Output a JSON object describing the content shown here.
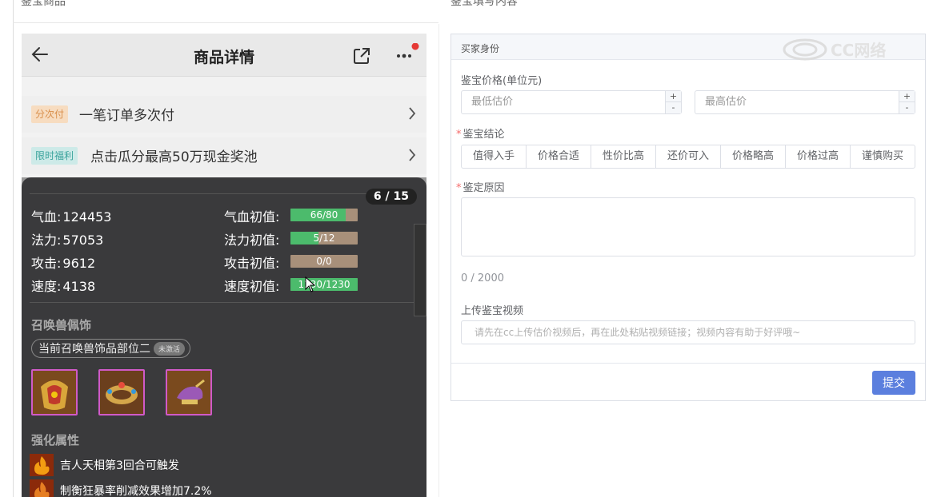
{
  "columns": {
    "left_title": "鉴宝商品",
    "right_title": "鉴宝填写内容"
  },
  "phone": {
    "nav": {
      "title": "商品详情"
    },
    "promos": [
      {
        "tag": "分次付",
        "text": "一笔订单多次付"
      },
      {
        "tag": "限时福利",
        "text": "点击瓜分最高50万现金奖池"
      }
    ],
    "page_indicator": "6 / 15",
    "stats": [
      {
        "label": "气血:",
        "value": "124453",
        "init_label": "气血初值:",
        "init_text": "66/80",
        "fill": 0.825
      },
      {
        "label": "法力:",
        "value": "57053",
        "init_label": "法力初值:",
        "init_text": "5/12",
        "fill": 0.42
      },
      {
        "label": "攻击:",
        "value": "9612",
        "init_label": "攻击初值:",
        "init_text": "0/0",
        "fill": 0
      },
      {
        "label": "速度:",
        "value": "4138",
        "init_label": "速度初值:",
        "init_text": "1230/1230",
        "fill": 1.0
      }
    ],
    "accessory_section": "召唤兽佩饰",
    "accessory_pill": "当前召唤兽饰品部位二",
    "accessory_lock": "未激活",
    "enhance_section": "强化属性",
    "enhancements": [
      "吉人天相第3回合可触发",
      "制衡狂暴率削减效果增加7.2%"
    ]
  },
  "form": {
    "header": "买家身份",
    "watermark": "CC网络",
    "price_label": "鉴宝价格(单位元)",
    "min_placeholder": "最低估价",
    "max_placeholder": "最高估价",
    "stepper_plus": "+",
    "stepper_minus": "-",
    "conclusion_label": "鉴宝结论",
    "conclusions": [
      "值得入手",
      "价格合适",
      "性价比高",
      "还价可入",
      "价格略高",
      "价格过高",
      "谨慎购买"
    ],
    "reason_label": "鉴定原因",
    "counter": "0 / 2000",
    "video_label": "上传鉴宝视频",
    "video_placeholder": "请先在cc上传估价视频后，再在此处粘贴视频链接；视频内容有助于好评哦~",
    "submit_label": "提交",
    "required_mark": "*"
  },
  "colors": {
    "bar_green": "#4cbb6c",
    "bar_empty": "#a8907a",
    "submit_blue": "#5b7fde",
    "badge_red": "#e53935"
  }
}
